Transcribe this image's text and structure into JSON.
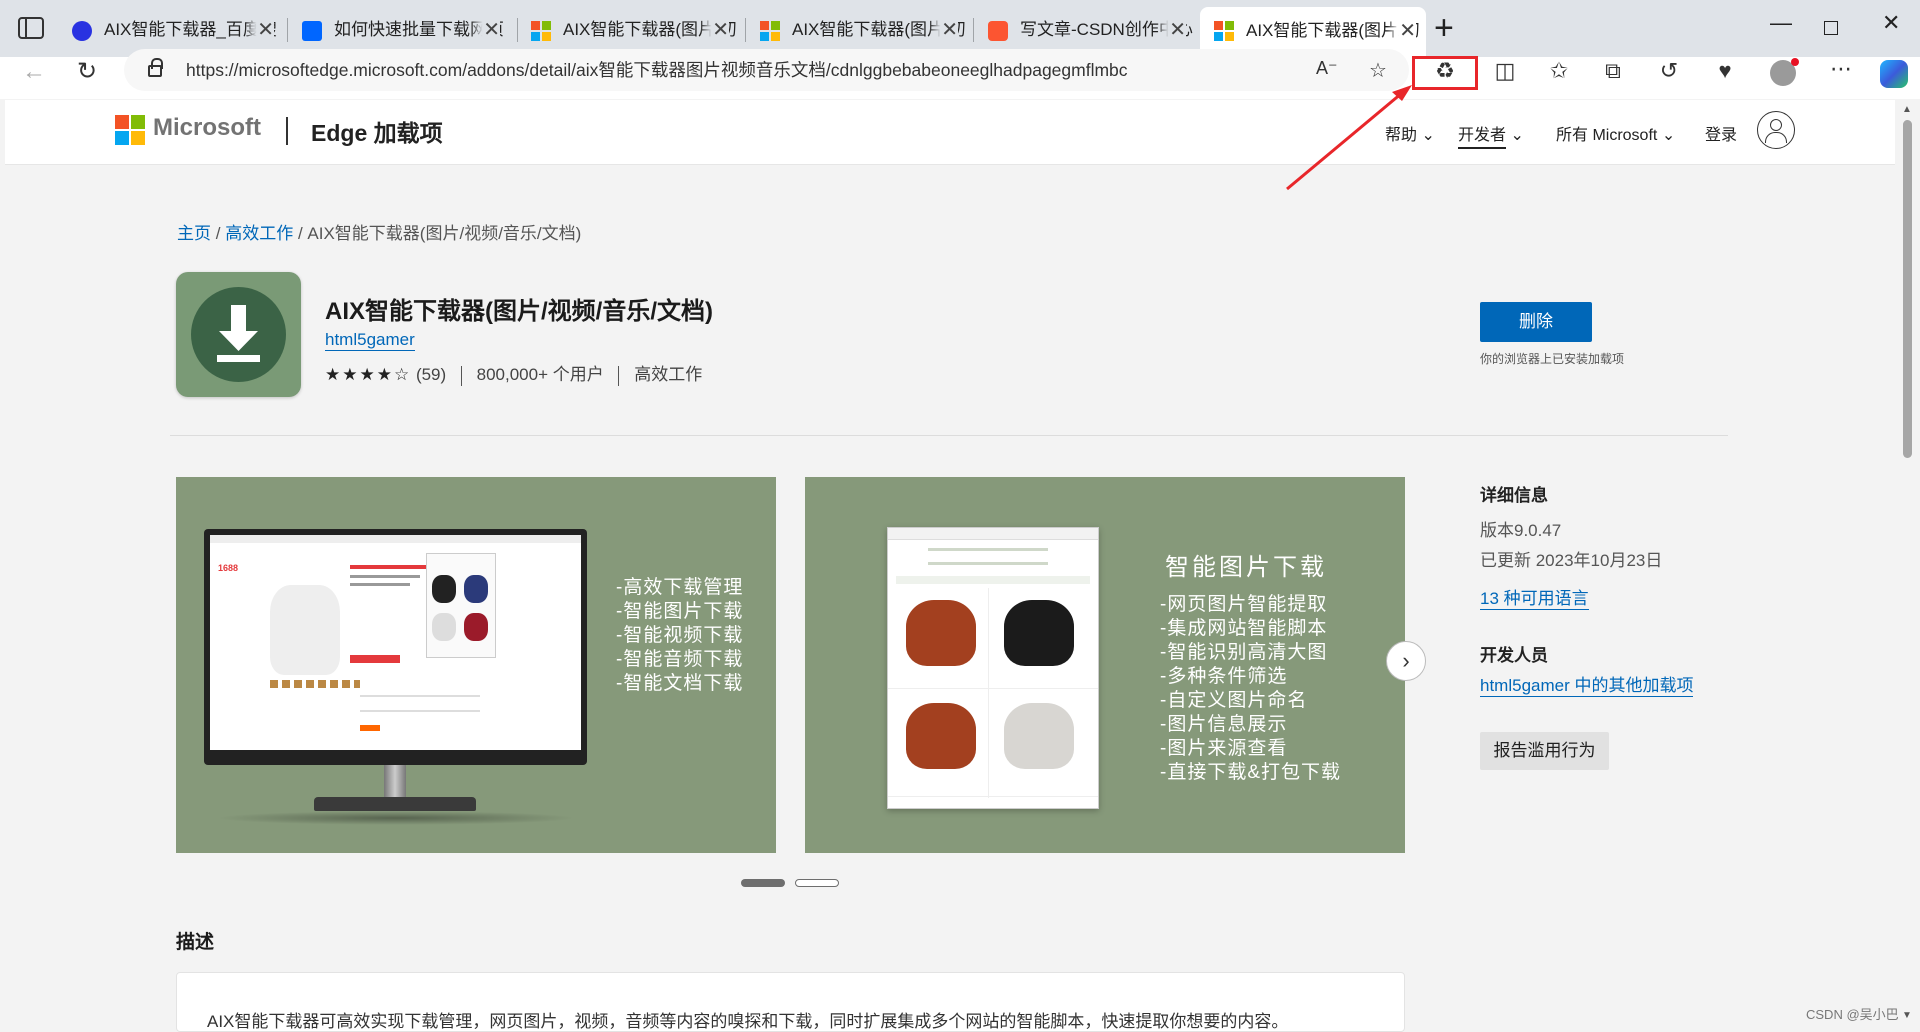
{
  "browser": {
    "tabs": [
      {
        "title": "AIX智能下载器_百度搜",
        "active": false,
        "favicon": "baidu-icon"
      },
      {
        "title": "如何快速批量下载网页",
        "active": false,
        "favicon": "zhihu-icon"
      },
      {
        "title": "AIX智能下载器(图片/初",
        "active": false,
        "favicon": "microsoft-icon"
      },
      {
        "title": "AIX智能下载器(图片/初",
        "active": false,
        "favicon": "microsoft-icon"
      },
      {
        "title": "写文章-CSDN创作中心",
        "active": false,
        "favicon": "csdn-icon"
      },
      {
        "title": "AIX智能下载器(图片/初",
        "active": true,
        "favicon": "microsoft-icon"
      }
    ],
    "close_glyph": "✕",
    "new_tab_glyph": "+",
    "address": "https://microsoftedge.microsoft.com/addons/detail/aix智能下载器图片视频音乐文档/cdnlggbebabeoneeglhadpagegmflmbc",
    "highlight_color": "#e8262a"
  },
  "site": {
    "brand": "Microsoft",
    "section": "Edge 加载项",
    "nav": {
      "help": "帮助",
      "developer": "开发者",
      "all_microsoft": "所有 Microsoft",
      "login": "登录"
    }
  },
  "breadcrumb": {
    "home": "主页",
    "category": "高效工作",
    "sep": "/",
    "current": "AIX智能下载器(图片/视频/音乐/文档)"
  },
  "addon": {
    "title": "AIX智能下载器(图片/视频/音乐/文档)",
    "developer": "html5gamer",
    "rating": 3.5,
    "stars": "★★★★☆",
    "rating_count": "(59)",
    "users": "800,000+ 个用户",
    "category": "高效工作",
    "remove_button": "删除",
    "installed_note": "你的浏览器上已安装加载项"
  },
  "screenshots": {
    "shot1_features": [
      "-高效下载管理",
      "-智能图片下载",
      "-智能视频下载",
      "-智能音频下载",
      "-智能文档下载"
    ],
    "shot2_title": "智能图片下载",
    "shot2_features": [
      "-网页图片智能提取",
      "-集成网站智能脚本",
      "-智能识别高清大图",
      "-多种条件筛选",
      "-自定义图片命名",
      "-图片信息展示",
      "-图片来源查看",
      "-直接下载&打包下载"
    ],
    "next_glyph": "›"
  },
  "details": {
    "heading": "详细信息",
    "version": "版本9.0.47",
    "updated": "已更新 2023年10月23日",
    "languages": "13 种可用语言",
    "dev_heading": "开发人员",
    "dev_link": "html5gamer 中的其他加载项",
    "report": "报告滥用行为"
  },
  "description": {
    "heading": "描述",
    "text": "AIX智能下载器可高效实现下载管理，网页图片，视频，音频等内容的嗅探和下载，同时扩展集成多个网站的智能脚本，快速提取你想要的内容。"
  },
  "watermark": "CSDN @吴小巴"
}
